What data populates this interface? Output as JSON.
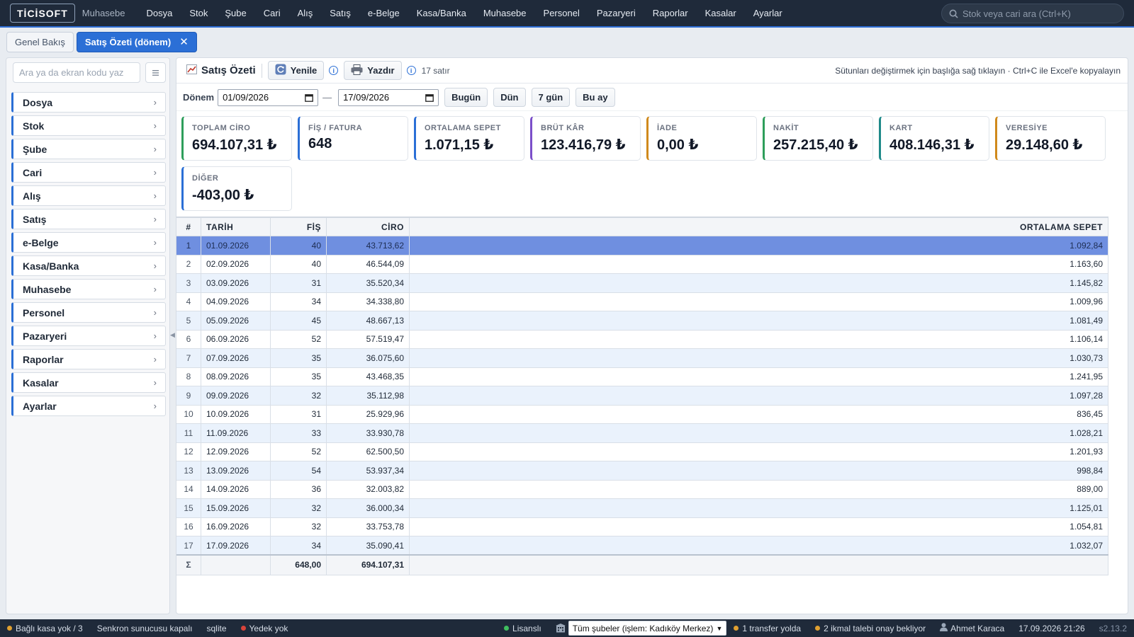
{
  "app": {
    "logo": "TİCİSOFT",
    "module": "Muhasebe"
  },
  "menu": [
    "Dosya",
    "Stok",
    "Şube",
    "Cari",
    "Alış",
    "Satış",
    "e-Belge",
    "Kasa/Banka",
    "Muhasebe",
    "Personel",
    "Pazaryeri",
    "Raporlar",
    "Kasalar",
    "Ayarlar"
  ],
  "search": {
    "placeholder": "Stok veya cari ara (Ctrl+K)"
  },
  "tabs": {
    "overview": "Genel Bakış",
    "active": "Satış Özeti (dönem)",
    "close": "✕"
  },
  "sidebar": {
    "search_placeholder": "Ara ya da ekran kodu yaz",
    "items": [
      "Dosya",
      "Stok",
      "Şube",
      "Cari",
      "Alış",
      "Satış",
      "e-Belge",
      "Kasa/Banka",
      "Muhasebe",
      "Personel",
      "Pazaryeri",
      "Raporlar",
      "Kasalar",
      "Ayarlar"
    ]
  },
  "toolbar": {
    "title": "Satış Özeti",
    "refresh": "Yenile",
    "print": "Yazdır",
    "row_count": "17 satır",
    "hint": "Sütunları değiştirmek için başlığa sağ tıklayın · Ctrl+C ile Excel'e kopyalayın"
  },
  "period": {
    "label": "Dönem",
    "from": "01/09/2026",
    "to": "17/09/2026",
    "buttons": [
      "Bugün",
      "Dün",
      "7 gün",
      "Bu ay"
    ]
  },
  "cards": [
    {
      "label": "TOPLAM CİRO",
      "value": "694.107,31 ₺",
      "color": "#2e9e5b"
    },
    {
      "label": "FİŞ / FATURA",
      "value": "648",
      "color": "#2b6fd6"
    },
    {
      "label": "ORTALAMA SEPET",
      "value": "1.071,15 ₺",
      "color": "#2b6fd6"
    },
    {
      "label": "BRÜT KÂR",
      "value": "123.416,79 ₺",
      "color": "#7b4fc9"
    },
    {
      "label": "İADE",
      "value": "0,00 ₺",
      "color": "#d08a1c"
    },
    {
      "label": "NAKİT",
      "value": "257.215,40 ₺",
      "color": "#2e9e5b"
    },
    {
      "label": "KART",
      "value": "408.146,31 ₺",
      "color": "#1f8a8a"
    },
    {
      "label": "VERESİYE",
      "value": "29.148,60 ₺",
      "color": "#d08a1c"
    },
    {
      "label": "DİĞER",
      "value": "-403,00 ₺",
      "color": "#2b6fd6"
    }
  ],
  "table": {
    "headers": [
      "#",
      "TARİH",
      "FİŞ",
      "CİRO",
      "ORTALAMA SEPET"
    ],
    "rows": [
      [
        "1",
        "01.09.2026",
        "40",
        "43.713,62",
        "1.092,84"
      ],
      [
        "2",
        "02.09.2026",
        "40",
        "46.544,09",
        "1.163,60"
      ],
      [
        "3",
        "03.09.2026",
        "31",
        "35.520,34",
        "1.145,82"
      ],
      [
        "4",
        "04.09.2026",
        "34",
        "34.338,80",
        "1.009,96"
      ],
      [
        "5",
        "05.09.2026",
        "45",
        "48.667,13",
        "1.081,49"
      ],
      [
        "6",
        "06.09.2026",
        "52",
        "57.519,47",
        "1.106,14"
      ],
      [
        "7",
        "07.09.2026",
        "35",
        "36.075,60",
        "1.030,73"
      ],
      [
        "8",
        "08.09.2026",
        "35",
        "43.468,35",
        "1.241,95"
      ],
      [
        "9",
        "09.09.2026",
        "32",
        "35.112,98",
        "1.097,28"
      ],
      [
        "10",
        "10.09.2026",
        "31",
        "25.929,96",
        "836,45"
      ],
      [
        "11",
        "11.09.2026",
        "33",
        "33.930,78",
        "1.028,21"
      ],
      [
        "12",
        "12.09.2026",
        "52",
        "62.500,50",
        "1.201,93"
      ],
      [
        "13",
        "13.09.2026",
        "54",
        "53.937,34",
        "998,84"
      ],
      [
        "14",
        "14.09.2026",
        "36",
        "32.003,82",
        "889,00"
      ],
      [
        "15",
        "15.09.2026",
        "32",
        "36.000,34",
        "1.125,01"
      ],
      [
        "16",
        "16.09.2026",
        "32",
        "33.753,78",
        "1.054,81"
      ],
      [
        "17",
        "17.09.2026",
        "34",
        "35.090,41",
        "1.032,07"
      ]
    ],
    "sum": {
      "symbol": "Σ",
      "fis": "648,00",
      "ciro": "694.107,31"
    }
  },
  "status": {
    "kasa": "Bağlı kasa yok / 3",
    "sync": "Senkron sunucusu kapalı",
    "db": "sqlite",
    "backup": "Yedek yok",
    "license": "Lisanslı",
    "branch": "Tüm şubeler (işlem: Kadıköy Merkez)",
    "transfer": "1 transfer yolda",
    "ikmal": "2 ikmal talebi onay bekliyor",
    "user": "Ahmet Karaca",
    "datetime": "17.09.2026 21:26",
    "version": "s2.13.2"
  },
  "colors": {
    "accent": "#2b6fd6",
    "topbar": "#1f2a3a",
    "selected_row": "#6f8fe0",
    "green": "#2e9e5b",
    "orange": "#d08a1c",
    "red": "#c0392b"
  }
}
